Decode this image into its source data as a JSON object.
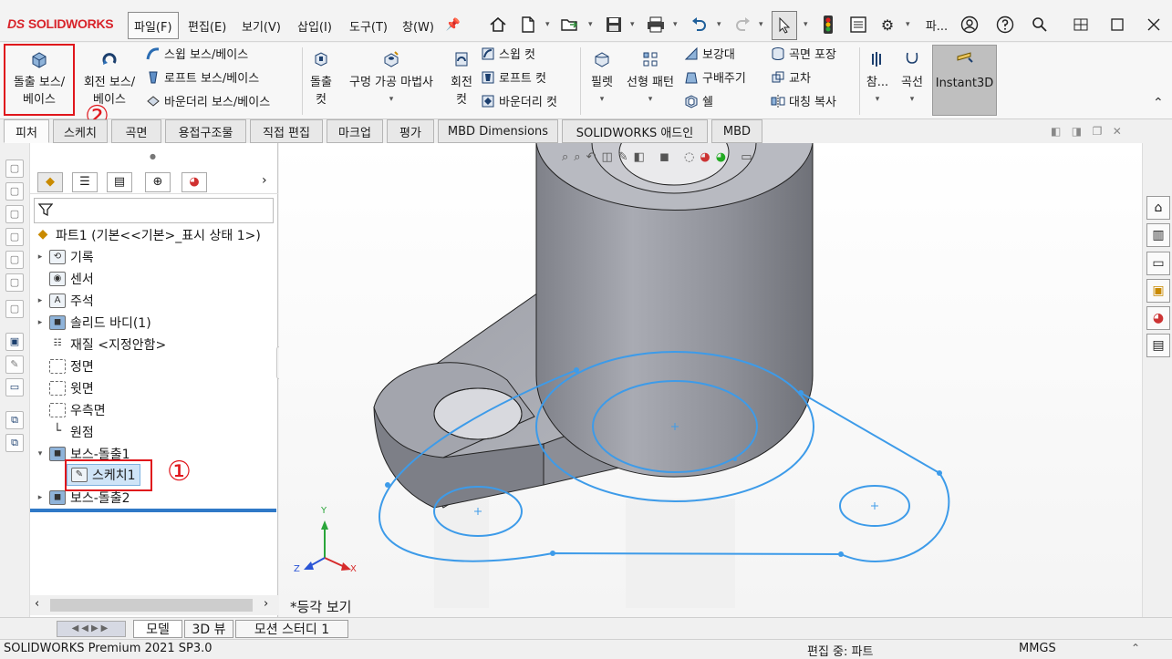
{
  "app": {
    "logo_ds": "DS",
    "logo_text": "SOLIDWORKS"
  },
  "menubar": {
    "items": [
      "파일(F)",
      "편집(E)",
      "보기(V)",
      "삽입(I)",
      "도구(T)",
      "창(W)"
    ],
    "pin_glyph": "📌",
    "overflow_label": "파..."
  },
  "toolbar_icons": [
    "home-icon",
    "new-doc-icon",
    "open-icon",
    "save-icon",
    "print-icon",
    "undo-icon",
    "redo-icon",
    "select-arrow-icon",
    "traffic-light-icon",
    "file-properties-icon",
    "options-gear-icon",
    "search-icon",
    "account-icon",
    "help-icon"
  ],
  "ribbon": {
    "extrude_boss": {
      "line1": "돌출 보스/",
      "line2": "베이스"
    },
    "revolve_boss": {
      "line1": "회전 보스/",
      "line2": "베이스"
    },
    "swept_boss": "스윕 보스/베이스",
    "loft_boss": "로프트 보스/베이스",
    "boundary_boss": "바운더리 보스/베이스",
    "extrude_cut": {
      "line1": "돌출",
      "line2": "컷"
    },
    "hole_wizard": "구멍 가공 마법사",
    "revolve_cut": {
      "line1": "회전",
      "line2": "컷"
    },
    "swept_cut": "스윕 컷",
    "loft_cut": "로프트 컷",
    "boundary_cut": "바운더리 컷",
    "fillet": "필렛",
    "linear_pattern": "선형 패턴",
    "rib": "보강대",
    "draft": "구배주기",
    "shell": "쉘",
    "wrap": "곡면 포장",
    "intersect": "교차",
    "mirror": "대칭 복사",
    "reference": "참...",
    "curves": "곡선",
    "instant3d": "Instant3D"
  },
  "annotations": {
    "step1": "①",
    "step2": "②"
  },
  "command_tabs": [
    "피처",
    "스케치",
    "곡면",
    "용접구조물",
    "직접 편집",
    "마크업",
    "평가",
    "MBD Dimensions",
    "SOLIDWORKS 애드인",
    "MBD"
  ],
  "tree": {
    "root": "파트1  (기본<<기본>_표시 상태 1>)",
    "items": [
      {
        "label": "기록",
        "expander": "▸"
      },
      {
        "label": "센서",
        "expander": ""
      },
      {
        "label": "주석",
        "expander": "▸"
      },
      {
        "label": "솔리드 바디(1)",
        "expander": "▸"
      },
      {
        "label": "재질 <지정안함>",
        "expander": ""
      },
      {
        "label": "정면",
        "expander": ""
      },
      {
        "label": "윗면",
        "expander": ""
      },
      {
        "label": "우측면",
        "expander": ""
      },
      {
        "label": "원점",
        "expander": ""
      },
      {
        "label": "보스-돌출1",
        "expander": "▾"
      },
      {
        "label": "스케치1",
        "expander": ""
      },
      {
        "label": "보스-돌출2",
        "expander": "▸"
      }
    ]
  },
  "viewport": {
    "view_label": "*등각 보기",
    "axis_x": "X",
    "axis_y": "Y",
    "axis_z": "Z"
  },
  "bottom_tabs": [
    "모델",
    "3D 뷰",
    "모션 스터디 1"
  ],
  "status": {
    "product": "SOLIDWORKS Premium 2021 SP3.0",
    "mode": "편집 중: 파트",
    "units": "MMGS"
  },
  "colors": {
    "accent_red": "#e0161c",
    "sketch_blue": "#3d9be9",
    "logo_red": "#d8232a"
  }
}
